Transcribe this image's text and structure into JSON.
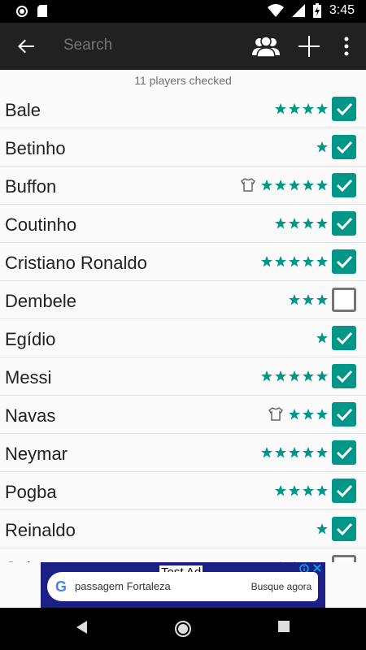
{
  "status_bar": {
    "time": "3:45"
  },
  "toolbar": {
    "search_placeholder": "Search"
  },
  "summary": {
    "checked_text": "11 players checked"
  },
  "players": [
    {
      "name": "Bale",
      "stars": 4,
      "shirt": false,
      "checked": true
    },
    {
      "name": "Betinho",
      "stars": 1,
      "shirt": false,
      "checked": true
    },
    {
      "name": "Buffon",
      "stars": 5,
      "shirt": true,
      "checked": true
    },
    {
      "name": "Coutinho",
      "stars": 4,
      "shirt": false,
      "checked": true
    },
    {
      "name": "Cristiano Ronaldo",
      "stars": 5,
      "shirt": false,
      "checked": true
    },
    {
      "name": "Dembele",
      "stars": 3,
      "shirt": false,
      "checked": false
    },
    {
      "name": "Egídio",
      "stars": 1,
      "shirt": false,
      "checked": true
    },
    {
      "name": "Messi",
      "stars": 5,
      "shirt": false,
      "checked": true
    },
    {
      "name": "Navas",
      "stars": 3,
      "shirt": true,
      "checked": true
    },
    {
      "name": "Neymar",
      "stars": 5,
      "shirt": false,
      "checked": true
    },
    {
      "name": "Pogba",
      "stars": 4,
      "shirt": false,
      "checked": true
    },
    {
      "name": "Reinaldo",
      "stars": 1,
      "shirt": false,
      "checked": true
    },
    {
      "name": "Sala",
      "stars": 4,
      "shirt": false,
      "checked": false
    }
  ],
  "ad": {
    "tag": "Test Ad",
    "query": "passagem Fortaleza",
    "cta": "Busque agora"
  },
  "colors": {
    "accent": "#009688",
    "toolbar": "#212121",
    "ad_background": "#1b1f86"
  }
}
